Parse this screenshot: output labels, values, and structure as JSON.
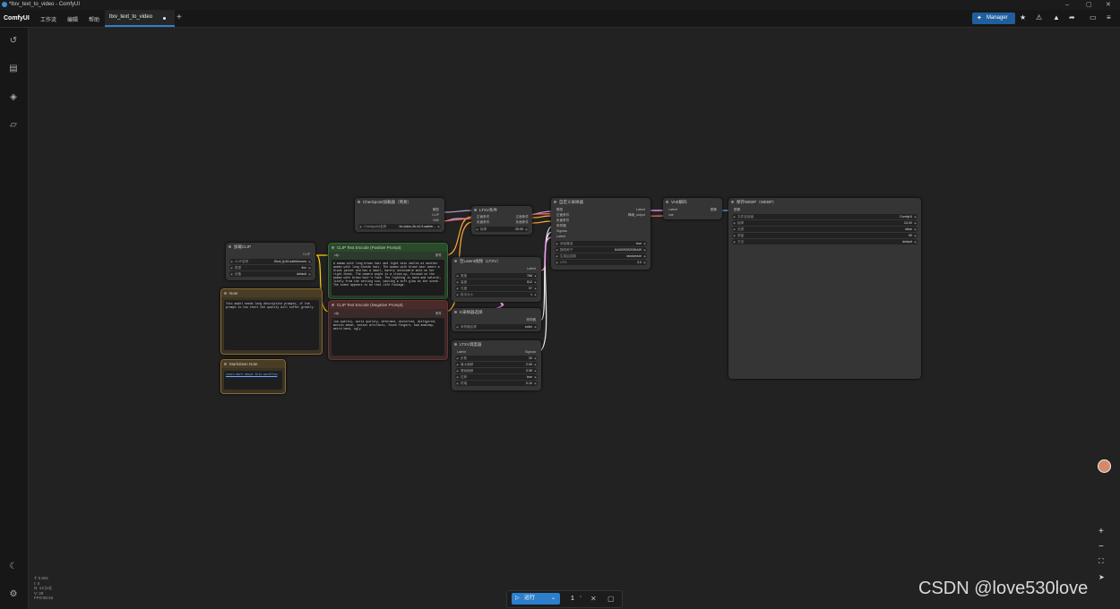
{
  "window": {
    "title": "*ltxv_text_to_video - ComfyUI",
    "min": "–",
    "max": "▢",
    "close": "✕"
  },
  "menubar": {
    "logo": "ComfyUI",
    "menus": [
      "工作流",
      "编辑",
      "帮助"
    ],
    "tab": "ltxv_text_to_video",
    "add_tab": "+",
    "manager_label": "Manager",
    "icons": [
      "star-icon",
      "puzzle-icon",
      "triangle-icon",
      "share-icon",
      "panel-icon",
      "hamburger-icon"
    ]
  },
  "sidebar": {
    "icons": [
      "history-icon",
      "queue-icon",
      "model-cube-icon",
      "folder-icon",
      "moon-icon",
      "settings-icon"
    ]
  },
  "stats": {
    "t": "T: 0.60s",
    "i": "I: 0",
    "n": "N: 13 [13]",
    "v": "V: 29",
    "fps": "FPS:50.52"
  },
  "runbar": {
    "run_label": "运行",
    "count": "1"
  },
  "watermark": "CSDN @love530love",
  "nodes": {
    "checkpoint": {
      "title": "Checkpoint加载器（简易）",
      "out_model": "模型",
      "out_clip": "CLIP",
      "out_vae": "VAE",
      "w_name": "Checkpoint名称",
      "w_val": "ltx-video-2b-v0.9.safete..."
    },
    "loadclip": {
      "title": "加载CLIP",
      "out": "CLIP",
      "w1k": "CLIP名称",
      "w1v": "t5xxl_fp16.safetensors",
      "w2k": "类型",
      "w2v": "ltxv",
      "w3k": "设备",
      "w3v": "default"
    },
    "pos": {
      "title": "CLIP Text Encode (Positive Prompt)",
      "in": "clip",
      "out": "条件",
      "text": "A woman with long brown hair and light skin smiles at another woman with long blonde hair. The woman with brown hair wears a black jacket and has a small, barely noticeable mole on her right cheek. The camera angle is a close-up, focused on the woman with brown hair's face. The lighting is warm and natural, likely from the setting sun, casting a soft glow on the scene. The scene appears to be real-life footage."
    },
    "neg": {
      "title": "CLIP Text Encode (Negative Prompt)",
      "in": "clip",
      "out": "条件",
      "text": "low quality, worst quality, deformed, distorted, disfigured, motion smear, motion artifacts, fused fingers, bad anatomy, weird hand, ugly"
    },
    "note": {
      "title": "Note",
      "text": "This model needs long descriptive prompts, if the prompt is too short the quality will suffer greatly."
    },
    "md": {
      "title": "Markdown Note",
      "text": "Learn more about this workflow"
    },
    "ltxcond": {
      "title": "LTXV条件",
      "in1": "正面条件",
      "in2": "负面条件",
      "out1": "正面条件",
      "out2": "负面条件",
      "wk": "帧率",
      "wv": "25.00"
    },
    "latent": {
      "title": "空Latent视频（LTXV）",
      "out": "Latent",
      "w": [
        [
          "宽度",
          "768"
        ],
        [
          "高度",
          "512"
        ],
        [
          "长度",
          "97"
        ],
        [
          "批次大小",
          "1"
        ]
      ]
    },
    "sampsel": {
      "title": "K采样器选择",
      "out": "采样器",
      "wk": "采样器名称",
      "wv": "euler"
    },
    "sched": {
      "title": "LTXV调度器",
      "in": "Latent",
      "out": "Sigmas",
      "w": [
        [
          "步数",
          "30"
        ],
        [
          "最大偏移",
          "2.05"
        ],
        [
          "基础偏移",
          "0.95"
        ],
        [
          "拉伸",
          "true"
        ],
        [
          "终端",
          "0.10"
        ]
      ]
    },
    "custom": {
      "title": "自定义采样器",
      "ins": [
        "模型",
        "正面条件",
        "负面条件",
        "采样器",
        "Sigmas",
        "Latent"
      ],
      "out1": "Latent",
      "out2": "降噪_output",
      "w": [
        [
          "添加噪波",
          "true"
        ],
        [
          "随机种子",
          "844009392036449"
        ],
        [
          "生成后控制",
          "randomize"
        ],
        [
          "CFG",
          "3.0"
        ]
      ]
    },
    "vae": {
      "title": "VAE解码",
      "in1": "Latent",
      "in2": "vae",
      "out": "图像"
    },
    "save": {
      "title": "保存WEBP（WEBP）",
      "in": "图像",
      "w": [
        [
          "文件名前缀",
          "ComfyUI"
        ],
        [
          "帧率",
          "24.00"
        ],
        [
          "无损",
          "false"
        ],
        [
          "质量",
          "90"
        ],
        [
          "方法",
          "default"
        ]
      ]
    }
  }
}
